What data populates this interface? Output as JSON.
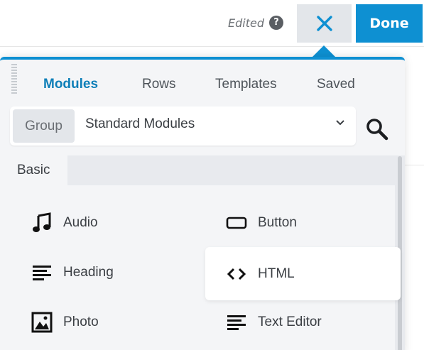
{
  "topbar": {
    "edited_label": "Edited",
    "help_icon": "?",
    "close_icon": "close-x",
    "done_label": "Done"
  },
  "tabs": [
    {
      "label": "Modules",
      "active": true
    },
    {
      "label": "Rows",
      "active": false
    },
    {
      "label": "Templates",
      "active": false
    },
    {
      "label": "Saved",
      "active": false
    }
  ],
  "group_select": {
    "label": "Group",
    "value": "Standard Modules"
  },
  "section": {
    "label": "Basic"
  },
  "modules": [
    {
      "label": "Audio",
      "icon": "music-note-icon"
    },
    {
      "label": "Button",
      "icon": "button-icon"
    },
    {
      "label": "Heading",
      "icon": "heading-icon"
    },
    {
      "label": "HTML",
      "icon": "code-icon"
    },
    {
      "label": "Photo",
      "icon": "image-icon"
    },
    {
      "label": "Text Editor",
      "icon": "text-editor-icon"
    }
  ],
  "colors": {
    "accent": "#0e90d2",
    "active_tab": "#0e7fb8"
  }
}
